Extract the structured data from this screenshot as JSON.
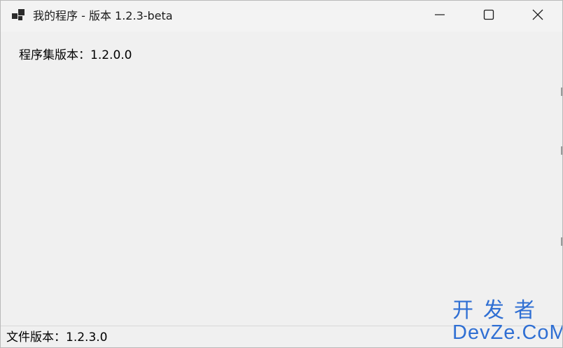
{
  "window": {
    "title": "我的程序 - 版本 1.2.3-beta",
    "icon": "app-window-icon"
  },
  "caption_buttons": {
    "minimize_icon": "minimize-icon",
    "maximize_icon": "maximize-icon",
    "close_icon": "close-icon"
  },
  "main": {
    "assembly_version_label": "程序集版本：1.2.0.0"
  },
  "status_bar": {
    "file_version_label": "文件版本：1.2.3.0"
  },
  "watermark": {
    "line1": "开发者",
    "line2": "DevZe.CoM",
    "color": "#2f6fd3"
  }
}
